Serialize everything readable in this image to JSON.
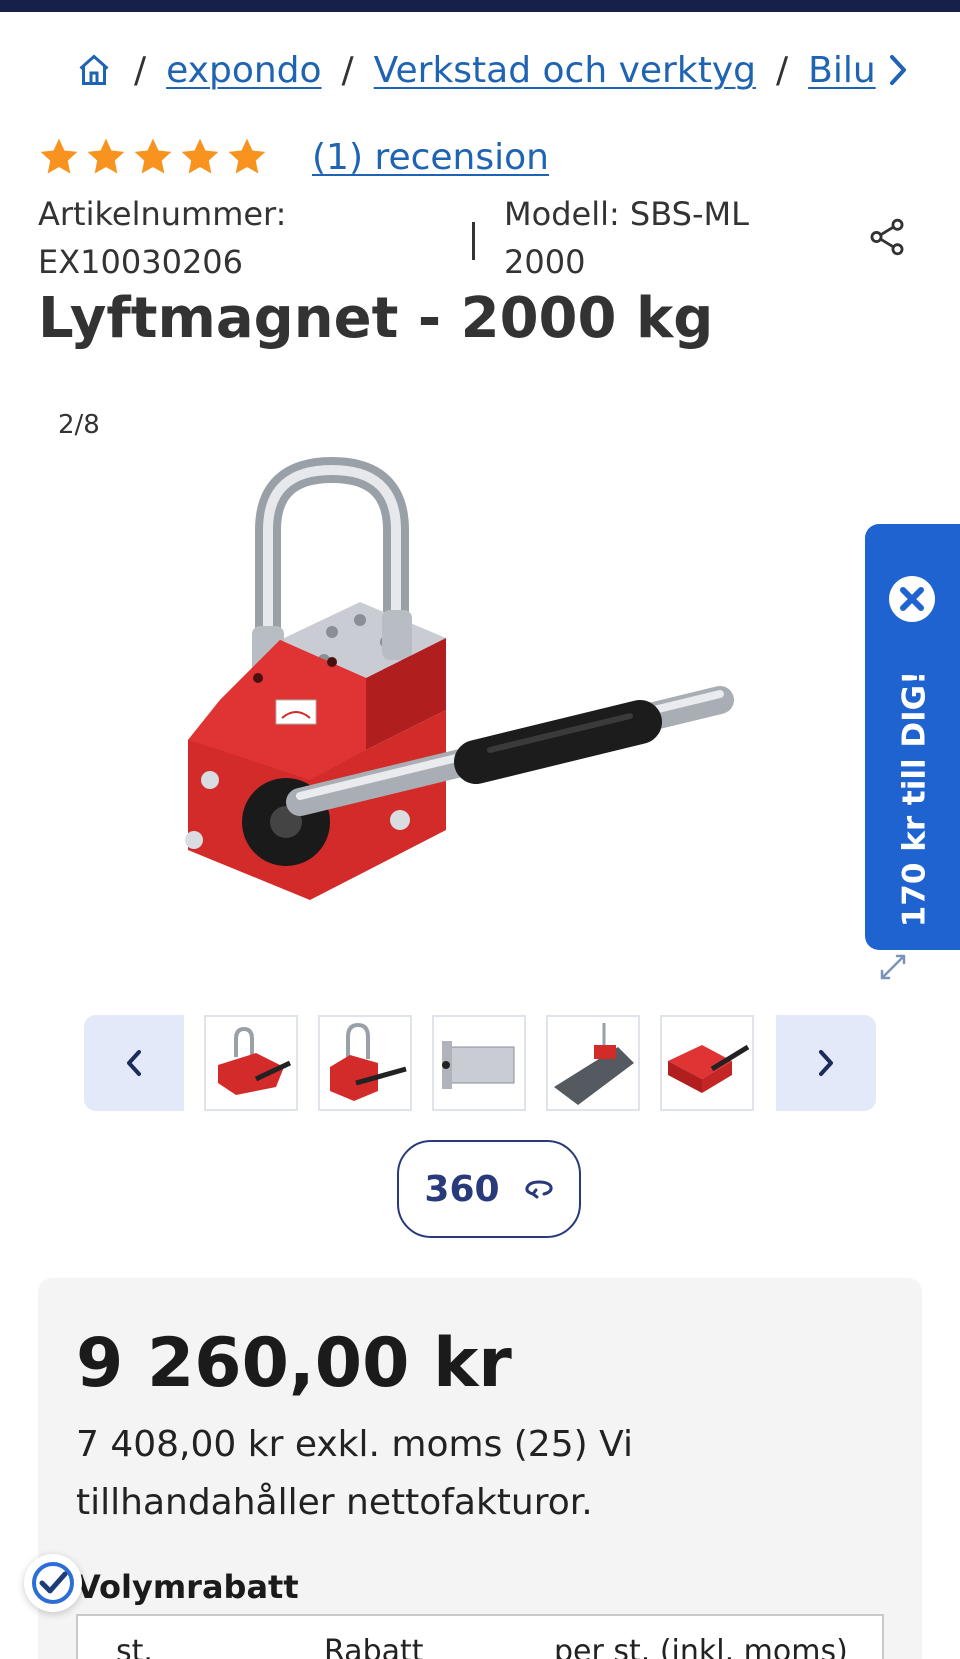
{
  "breadcrumb": {
    "items": [
      "expondo",
      "Verkstad och verktyg",
      "Bilu"
    ],
    "separator": "/"
  },
  "rating": {
    "stars": 5,
    "max": 5,
    "review_link": "(1) recension"
  },
  "meta": {
    "article_label": "Artikelnummer:",
    "article_number": "EX10030206",
    "model_line1": "Modell: SBS-ML",
    "model_line2": "2000"
  },
  "product": {
    "title": "Lyftmagnet - 2000 kg"
  },
  "gallery": {
    "counter": "2/8",
    "view360": "360"
  },
  "promo": {
    "text": "170 kr till DIG!"
  },
  "price": {
    "main": "9 260,00 kr",
    "net_line": "7 408,00 kr exkl. moms (25) Vi tillhandahåller nettofakturor."
  },
  "volume": {
    "title": "Volymrabatt",
    "headers": [
      "st.",
      "Rabatt",
      "per st. (inkl. moms)"
    ]
  },
  "colors": {
    "link": "#1f63b3",
    "star": "#f7931e",
    "promo": "#1f63d1",
    "dark_navy": "#283a7a"
  }
}
